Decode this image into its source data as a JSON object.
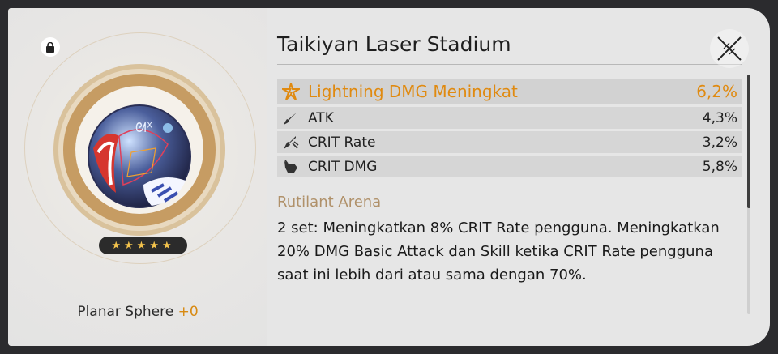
{
  "item": {
    "title": "Taikiyan Laser Stadium",
    "type_label": "Planar Sphere",
    "level": "+0",
    "stars": "★★★★★",
    "locked": true
  },
  "main_stat": {
    "name": "Lightning DMG Meningkat",
    "value": "6,2%",
    "icon": "lightning-dmg-icon"
  },
  "sub_stats": [
    {
      "name": "ATK",
      "value": "4,3%",
      "icon": "atk-sword-icon"
    },
    {
      "name": "CRIT Rate",
      "value": "3,2%",
      "icon": "crit-rate-icon"
    },
    {
      "name": "CRIT DMG",
      "value": "5,8%",
      "icon": "crit-dmg-icon"
    }
  ],
  "set": {
    "name": "Rutilant Arena",
    "description": "2 set: Meningkatkan 8% CRIT Rate pengguna. Meningkatkan 20% DMG Basic Attack dan Skill ketika CRIT Rate pengguna saat ini lebih dari atau sama dengan 70%."
  },
  "colors": {
    "accent": "#e08a10",
    "set_name": "#b0916a",
    "star": "#f2c24c"
  }
}
